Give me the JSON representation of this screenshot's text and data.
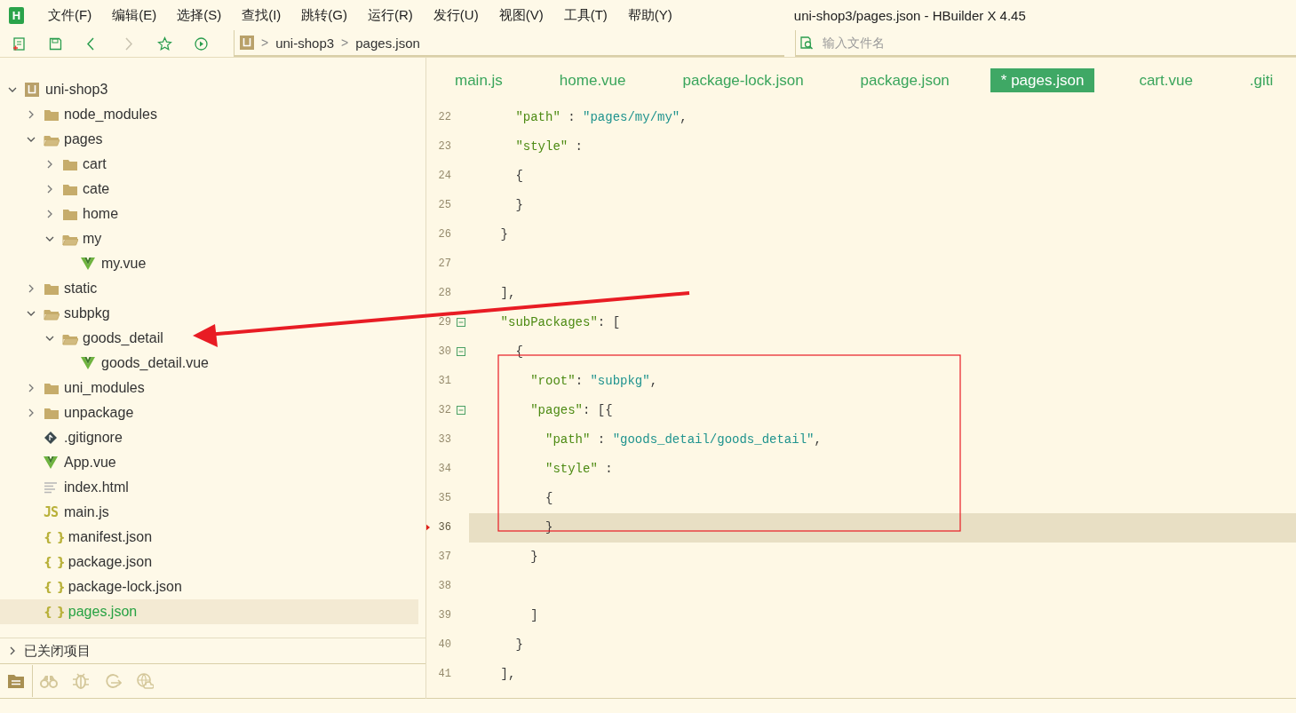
{
  "app_logo": "H",
  "menu": [
    "文件(F)",
    "编辑(E)",
    "选择(S)",
    "查找(I)",
    "跳转(G)",
    "运行(R)",
    "发行(U)",
    "视图(V)",
    "工具(T)",
    "帮助(Y)"
  ],
  "window": {
    "title": "uni-shop3/pages.json - HBuilder X 4.45"
  },
  "toolbar": {
    "forward_disabled": true
  },
  "breadcrumb": {
    "items": [
      "uni-shop3",
      "pages.json"
    ],
    "separator": ">"
  },
  "search": {
    "placeholder": "输入文件名"
  },
  "tree": [
    {
      "label": "uni-shop3",
      "kind": "project",
      "expanded": true,
      "selected": false,
      "children": [
        {
          "label": "node_modules",
          "kind": "folder",
          "expanded": false,
          "selected": false
        },
        {
          "label": "pages",
          "kind": "folder",
          "expanded": true,
          "selected": false,
          "children": [
            {
              "label": "cart",
              "kind": "folder",
              "expanded": false,
              "selected": false
            },
            {
              "label": "cate",
              "kind": "folder",
              "expanded": false,
              "selected": false
            },
            {
              "label": "home",
              "kind": "folder",
              "expanded": false,
              "selected": false
            },
            {
              "label": "my",
              "kind": "folder",
              "expanded": true,
              "selected": false,
              "children": [
                {
                  "label": "my.vue",
                  "kind": "vue",
                  "selected": false
                }
              ]
            }
          ]
        },
        {
          "label": "static",
          "kind": "folder",
          "expanded": false,
          "selected": false
        },
        {
          "label": "subpkg",
          "kind": "folder",
          "expanded": true,
          "selected": false,
          "children": [
            {
              "label": "goods_detail",
              "kind": "folder",
              "expanded": true,
              "selected": false,
              "children": [
                {
                  "label": "goods_detail.vue",
                  "kind": "vue",
                  "selected": false
                }
              ]
            }
          ]
        },
        {
          "label": "uni_modules",
          "kind": "folder",
          "expanded": false,
          "selected": false
        },
        {
          "label": "unpackage",
          "kind": "folder",
          "expanded": false,
          "selected": false
        },
        {
          "label": ".gitignore",
          "kind": "git",
          "selected": false
        },
        {
          "label": "App.vue",
          "kind": "vue",
          "selected": false
        },
        {
          "label": "index.html",
          "kind": "html",
          "selected": false
        },
        {
          "label": "main.js",
          "kind": "js",
          "icon_text": "JS",
          "selected": false
        },
        {
          "label": "manifest.json",
          "kind": "json",
          "icon_text": "{ }",
          "selected": false
        },
        {
          "label": "package.json",
          "kind": "json",
          "icon_text": "{ }",
          "selected": false
        },
        {
          "label": "package-lock.json",
          "kind": "json",
          "icon_text": "{ }",
          "selected": false
        },
        {
          "label": "pages.json",
          "kind": "json",
          "icon_text": "{ }",
          "selected": true
        }
      ]
    }
  ],
  "closed_projects": {
    "label": "已关闭项目",
    "expanded": false
  },
  "bottom_tabs": [
    {
      "selected": true
    },
    {
      "selected": false
    },
    {
      "selected": false
    },
    {
      "selected": false
    },
    {
      "selected": false
    }
  ],
  "tabs": [
    {
      "label": "main.js",
      "selected": false
    },
    {
      "label": "home.vue",
      "selected": false
    },
    {
      "label": "package-lock.json",
      "selected": false
    },
    {
      "label": "package.json",
      "selected": false
    },
    {
      "label": "* pages.json",
      "selected": true
    },
    {
      "label": "cart.vue",
      "selected": false
    },
    {
      "label": ".giti",
      "selected": false
    }
  ],
  "code": {
    "lines": [
      {
        "number": "22",
        "fold": false,
        "current": false,
        "tokens": [
          {
            "kind": "key",
            "text": "      \"path\""
          },
          {
            "kind": "punct",
            "text": " : "
          },
          {
            "kind": "string",
            "text": "\"pages/my/my\""
          },
          {
            "kind": "punct",
            "text": ","
          }
        ]
      },
      {
        "number": "23",
        "fold": false,
        "current": false,
        "tokens": [
          {
            "kind": "key",
            "text": "      \"style\""
          },
          {
            "kind": "punct",
            "text": " :"
          }
        ]
      },
      {
        "number": "24",
        "fold": false,
        "current": false,
        "tokens": [
          {
            "kind": "punct",
            "text": "      {"
          }
        ]
      },
      {
        "number": "25",
        "fold": false,
        "current": false,
        "tokens": [
          {
            "kind": "punct",
            "text": "      }"
          }
        ]
      },
      {
        "number": "26",
        "fold": false,
        "current": false,
        "tokens": [
          {
            "kind": "punct",
            "text": "    }"
          }
        ]
      },
      {
        "number": "27",
        "fold": false,
        "current": false
      },
      {
        "number": "28",
        "fold": false,
        "current": false,
        "tokens": [
          {
            "kind": "punct",
            "text": "    ],"
          }
        ]
      },
      {
        "number": "29",
        "fold": true,
        "current": false,
        "tokens": [
          {
            "kind": "key",
            "text": "    \"subPackages\""
          },
          {
            "kind": "punct",
            "text": ": ["
          }
        ]
      },
      {
        "number": "30",
        "fold": true,
        "current": false,
        "tokens": [
          {
            "kind": "punct",
            "text": "      {"
          }
        ]
      },
      {
        "number": "31",
        "fold": false,
        "current": false,
        "tokens": [
          {
            "kind": "key",
            "text": "        \"root\""
          },
          {
            "kind": "punct",
            "text": ": "
          },
          {
            "kind": "string",
            "text": "\"subpkg\""
          },
          {
            "kind": "punct",
            "text": ","
          }
        ]
      },
      {
        "number": "32",
        "fold": true,
        "current": false,
        "tokens": [
          {
            "kind": "key",
            "text": "        \"pages\""
          },
          {
            "kind": "punct",
            "text": ": [{"
          }
        ]
      },
      {
        "number": "33",
        "fold": false,
        "current": false,
        "tokens": [
          {
            "kind": "key",
            "text": "          \"path\""
          },
          {
            "kind": "punct",
            "text": " : "
          },
          {
            "kind": "string",
            "text": "\"goods_detail/goods_detail\""
          },
          {
            "kind": "punct",
            "text": ","
          }
        ]
      },
      {
        "number": "34",
        "fold": false,
        "current": false,
        "tokens": [
          {
            "kind": "key",
            "text": "          \"style\""
          },
          {
            "kind": "punct",
            "text": " :"
          }
        ]
      },
      {
        "number": "35",
        "fold": false,
        "current": false,
        "tokens": [
          {
            "kind": "punct",
            "text": "          {"
          }
        ]
      },
      {
        "number": "36",
        "fold": false,
        "current": true,
        "tokens": [
          {
            "kind": "punct",
            "text": "          }"
          }
        ]
      },
      {
        "number": "37",
        "fold": false,
        "current": false,
        "tokens": [
          {
            "kind": "punct",
            "text": "        }"
          }
        ]
      },
      {
        "number": "38",
        "fold": false,
        "current": false
      },
      {
        "number": "39",
        "fold": false,
        "current": false,
        "tokens": [
          {
            "kind": "punct",
            "text": "        ]"
          }
        ]
      },
      {
        "number": "40",
        "fold": false,
        "current": false,
        "tokens": [
          {
            "kind": "punct",
            "text": "      }"
          }
        ]
      },
      {
        "number": "41",
        "fold": false,
        "current": false,
        "tokens": [
          {
            "kind": "punct",
            "text": "    ],"
          }
        ]
      }
    ]
  },
  "annotations": [
    {
      "kind": "arrow"
    },
    {
      "kind": "rectangle"
    }
  ]
}
